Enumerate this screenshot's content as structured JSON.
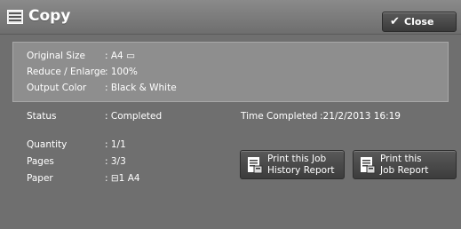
{
  "header": {
    "title": "Copy",
    "close_label": "Close"
  },
  "summary": {
    "original_size": {
      "label": "Original Size",
      "value": ": A4 ▭"
    },
    "reduce_enlarge": {
      "label": "Reduce / Enlarge",
      "value": ": 100%"
    },
    "output_color": {
      "label": "Output Color",
      "value": ": Black & White"
    }
  },
  "details": {
    "status": {
      "label": "Status",
      "value": ": Completed"
    },
    "time_completed": {
      "label": "Time Completed",
      "value": ":21/2/2013 16:19"
    },
    "quantity": {
      "label": "Quantity",
      "value": ": 1/1"
    },
    "pages": {
      "label": "Pages",
      "value": ": 3/3"
    },
    "paper": {
      "label": "Paper",
      "value": ": ⊟1 A4"
    }
  },
  "buttons": {
    "print_history": "Print this Job\nHistory Report",
    "print_job": "Print this\nJob Report"
  },
  "icons": {
    "app": "copy-icon",
    "close": "checkmark-icon",
    "report": "report-print-icon"
  }
}
